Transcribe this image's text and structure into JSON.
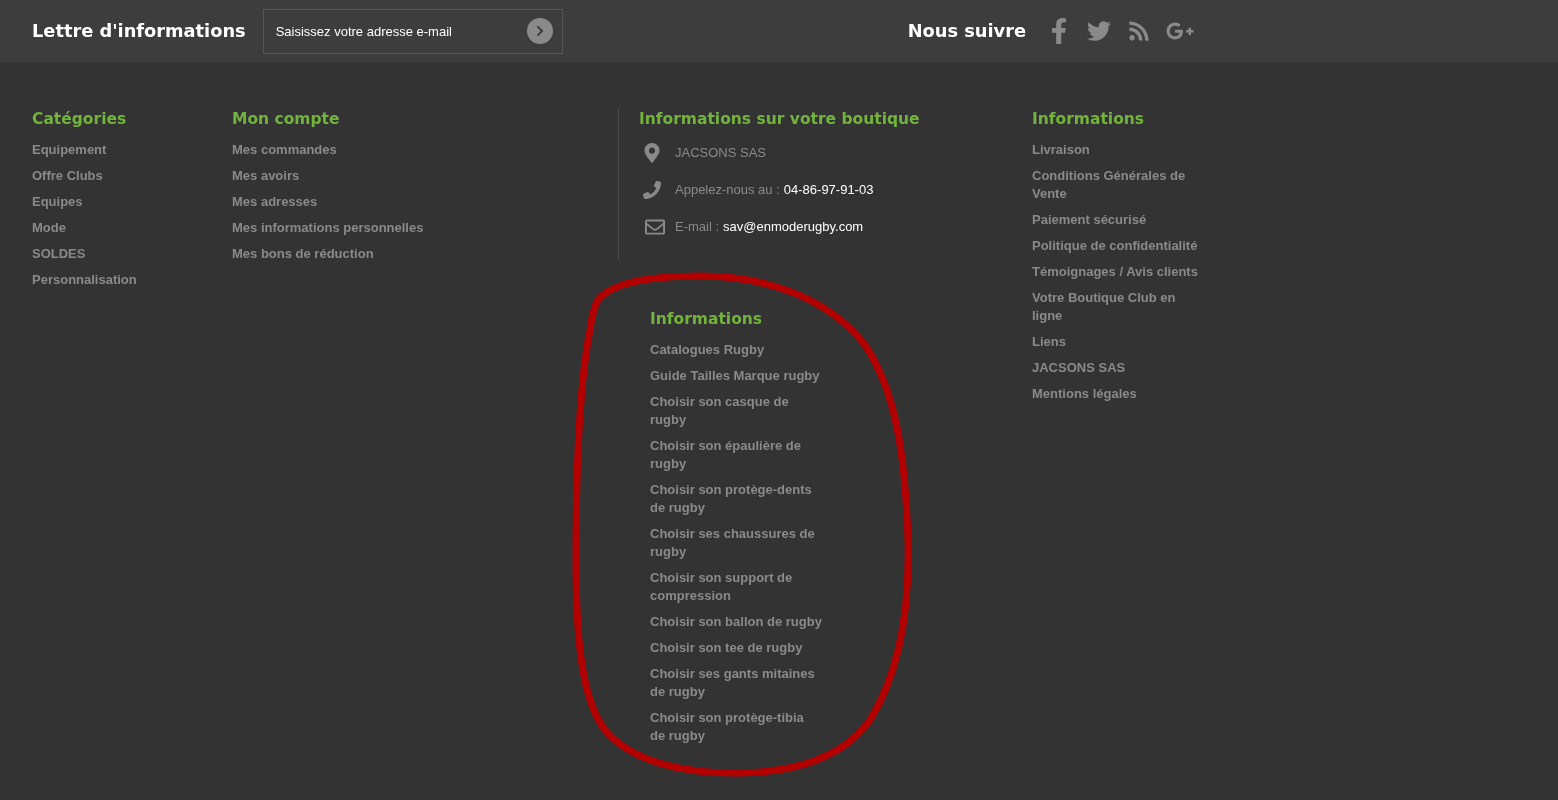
{
  "newsletter": {
    "title": "Lettre d'informations",
    "placeholder": "Saisissez votre adresse e-mail"
  },
  "follow": {
    "title": "Nous suivre"
  },
  "categories": {
    "title": "Catégories",
    "items": [
      "Equipement",
      "Offre Clubs",
      "Equipes",
      "Mode",
      "SOLDES",
      "Personnalisation"
    ]
  },
  "account": {
    "title": "Mon compte",
    "items": [
      "Mes commandes",
      "Mes avoirs",
      "Mes adresses",
      "Mes informations personnelles",
      "Mes bons de réduction"
    ]
  },
  "shop_info": {
    "title": "Informations sur votre boutique",
    "contacts": [
      {
        "kind": "location",
        "label": "JACSONS SAS"
      },
      {
        "kind": "phone",
        "label": "Appelez-nous au :",
        "value": "04-86-97-91-03"
      },
      {
        "kind": "email",
        "label": "E-mail :",
        "value": "sav@enmoderugby.com"
      }
    ]
  },
  "guides": {
    "title": "Informations",
    "items": [
      "Catalogues Rugby",
      "Guide Tailles Marque rugby",
      "Choisir son casque de rugby",
      "Choisir son épaulière de rugby",
      "Choisir son protège-dents de rugby",
      "Choisir ses chaussures de rugby",
      "Choisir son support de compression",
      "Choisir son ballon de rugby",
      "Choisir son tee de rugby",
      "Choisir ses gants mitaines de rugby",
      "Choisir son protège-tibia de rugby"
    ]
  },
  "information": {
    "title": "Informations",
    "items": [
      "Livraison",
      "Conditions Générales de Vente",
      "Paiement sécurisé",
      "Politique de confidentialité",
      "Témoignages / Avis clients",
      "Votre Boutique Club en ligne",
      "Liens",
      "JACSONS SAS",
      "Mentions légales"
    ]
  }
}
